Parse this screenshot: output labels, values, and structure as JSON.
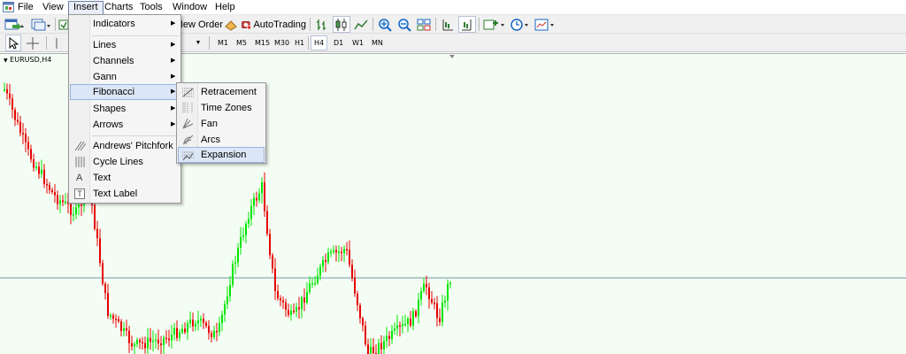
{
  "menubar": {
    "items": [
      {
        "id": "file",
        "label": "File"
      },
      {
        "id": "view",
        "label": "View"
      },
      {
        "id": "insert",
        "label": "Insert"
      },
      {
        "id": "charts",
        "label": "Charts"
      },
      {
        "id": "tools",
        "label": "Tools"
      },
      {
        "id": "window",
        "label": "Window"
      },
      {
        "id": "help",
        "label": "Help"
      }
    ]
  },
  "toolbar": {
    "new_order_label": "New Order",
    "autotrading_label": "AutoTrading",
    "timeframes": [
      "M1",
      "M5",
      "M15",
      "M30",
      "H1",
      "H4",
      "D1",
      "W1",
      "MN"
    ],
    "active_timeframe": "H4",
    "icons": [
      "new-chart-icon",
      "profiles-icon",
      "navigator-icon",
      "new-order-icon",
      "autotrading-icon",
      "bar-chart-icon",
      "candlestick-icon",
      "line-chart-icon",
      "zoom-in-icon",
      "zoom-out-icon",
      "tile-windows-icon",
      "chart-shift-icon",
      "autoscroll-icon",
      "indicators-icon",
      "periods-icon",
      "templates-icon",
      "cursor-icon",
      "crosshair-icon",
      "vertical-line-icon"
    ]
  },
  "chart": {
    "title": "EURUSD,H4",
    "colors": {
      "background": "#f4fdf4",
      "bull": "#00e600",
      "bear": "#e60000",
      "grid_line": "#6f98a8"
    }
  },
  "insert_menu": {
    "items": [
      {
        "label": "Indicators",
        "has_submenu": true,
        "icon": ""
      },
      {
        "label": "Lines",
        "has_submenu": true,
        "icon": ""
      },
      {
        "label": "Channels",
        "has_submenu": true,
        "icon": ""
      },
      {
        "label": "Gann",
        "has_submenu": true,
        "icon": ""
      },
      {
        "label": "Fibonacci",
        "has_submenu": true,
        "icon": "",
        "highlighted": true
      },
      {
        "label": "Shapes",
        "has_submenu": true,
        "icon": ""
      },
      {
        "label": "Arrows",
        "has_submenu": true,
        "icon": ""
      },
      {
        "label": "Andrews' Pitchfork",
        "has_submenu": false,
        "icon": "pitchfork-icon"
      },
      {
        "label": "Cycle Lines",
        "has_submenu": false,
        "icon": "cycle-lines-icon"
      },
      {
        "label": "Text",
        "has_submenu": false,
        "icon": "text-icon",
        "glyph": "A"
      },
      {
        "label": "Text Label",
        "has_submenu": false,
        "icon": "text-label-icon",
        "glyph": "T"
      }
    ]
  },
  "fibonacci_submenu": {
    "items": [
      {
        "label": "Retracement",
        "icon": "fib-retracement-icon"
      },
      {
        "label": "Time Zones",
        "icon": "fib-time-zones-icon"
      },
      {
        "label": "Fan",
        "icon": "fib-fan-icon"
      },
      {
        "label": "Arcs",
        "icon": "fib-arcs-icon"
      },
      {
        "label": "Expansion",
        "icon": "fib-expansion-icon",
        "highlighted": true
      }
    ]
  }
}
